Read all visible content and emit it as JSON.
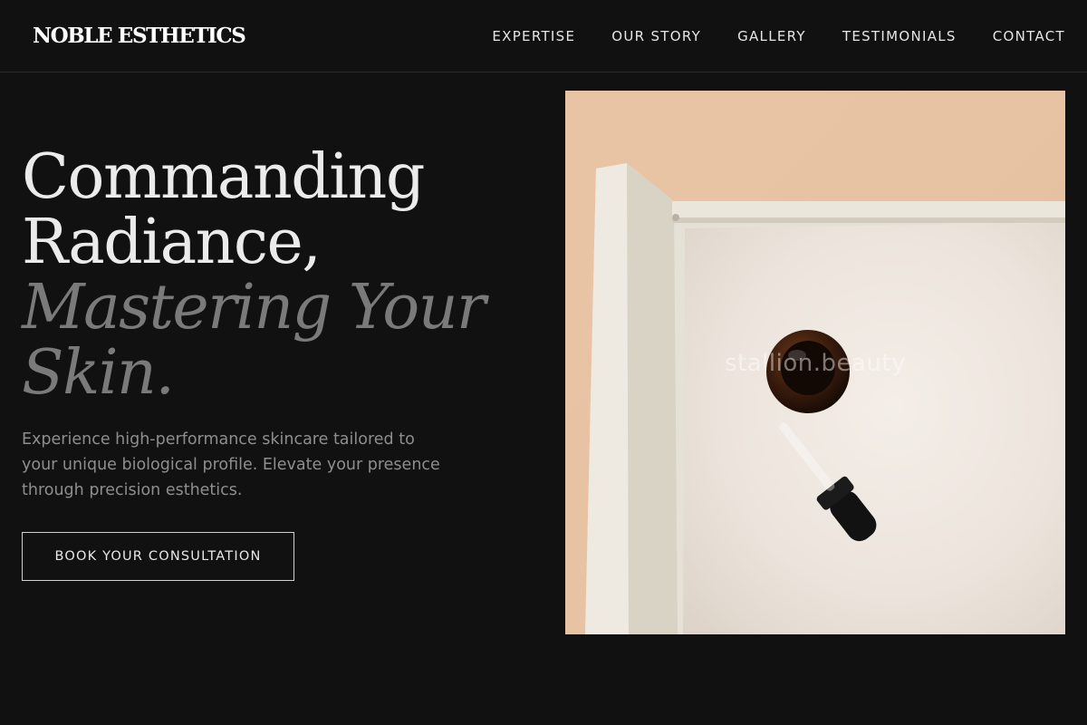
{
  "header": {
    "logo": "NOBLE ESTHETICS",
    "nav": [
      {
        "label": "EXPERTISE"
      },
      {
        "label": "OUR STORY"
      },
      {
        "label": "GALLERY"
      },
      {
        "label": "TESTIMONIALS"
      },
      {
        "label": "CONTACT"
      }
    ]
  },
  "hero": {
    "headline_line1": "Commanding",
    "headline_line2": "Radiance,",
    "headline_italic": "Mastering Your Skin.",
    "subtext": "Experience high-performance skincare tailored to your unique biological profile. Elevate your presence through precision esthetics.",
    "cta_label": "BOOK YOUR CONSULTATION",
    "image": {
      "watermark": "stallion.beauty",
      "description_icon": "serum-bottle-dropper-photo"
    }
  },
  "colors": {
    "background": "#111111",
    "text_primary": "#ebebeb",
    "text_muted": "#7a7a7a",
    "subtext": "#8e8e8e"
  }
}
